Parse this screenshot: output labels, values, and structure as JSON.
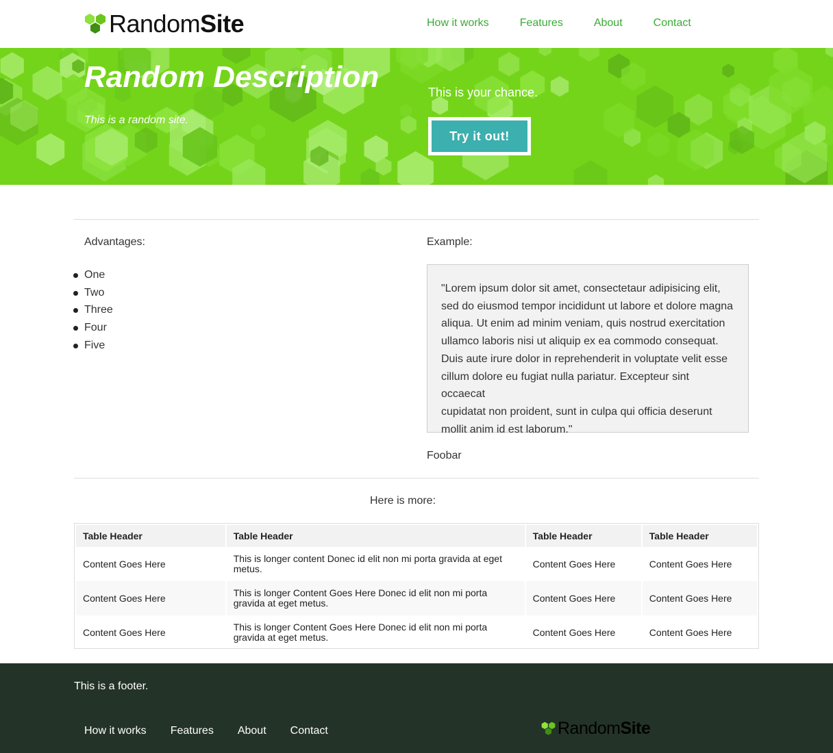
{
  "brand": {
    "name_regular": "Random",
    "name_bold": "Site",
    "logo_color": "#74d41a"
  },
  "nav": [
    "How it works",
    "Features",
    "About",
    "Contact"
  ],
  "hero": {
    "title": "Random Description",
    "subtitle": "This is a random site.",
    "chance_text": "This is your chance.",
    "cta_label": "Try it out!",
    "bg_color": "#74d41a",
    "cta_color": "#3cafaf"
  },
  "advantages": {
    "heading": "Advantages:",
    "items": [
      "One",
      "Two",
      "Three",
      "Four",
      "Five"
    ]
  },
  "example": {
    "heading": "Example:",
    "quote_lines": [
      "\"Lorem ipsum dolor sit amet, consectetaur adipisicing elit,",
      "sed do eiusmod tempor incididunt ut labore et dolore magna",
      "aliqua. Ut enim ad minim veniam, quis nostrud exercitation",
      "ullamco laboris nisi ut aliquip ex ea commodo consequat.",
      "Duis aute irure dolor in reprehenderit in voluptate velit esse",
      "cillum dolore eu fugiat nulla pariatur. Excepteur sint occaecat",
      "cupidatat non proident, sunt in culpa qui officia deserunt",
      "mollit anim id est laborum.\""
    ],
    "footnote": "Foobar"
  },
  "more": {
    "heading": "Here is more:",
    "table": {
      "headers": [
        "Table Header",
        "Table Header",
        "Table Header",
        "Table Header"
      ],
      "rows": [
        [
          "Content Goes Here",
          "This is longer content Donec id elit non mi porta gravida at eget metus.",
          "Content Goes Here",
          "Content Goes Here"
        ],
        [
          "Content Goes Here",
          "This is longer Content Goes Here Donec id elit non mi porta gravida at eget metus.",
          "Content Goes Here",
          "Content Goes Here"
        ],
        [
          "Content Goes Here",
          "This is longer Content Goes Here Donec id elit non mi porta gravida at eget metus.",
          "Content Goes Here",
          "Content Goes Here"
        ]
      ]
    }
  },
  "footer": {
    "text": "This is a footer.",
    "nav": [
      "How it works",
      "Features",
      "About",
      "Contact"
    ],
    "bg_color": "#243327"
  }
}
